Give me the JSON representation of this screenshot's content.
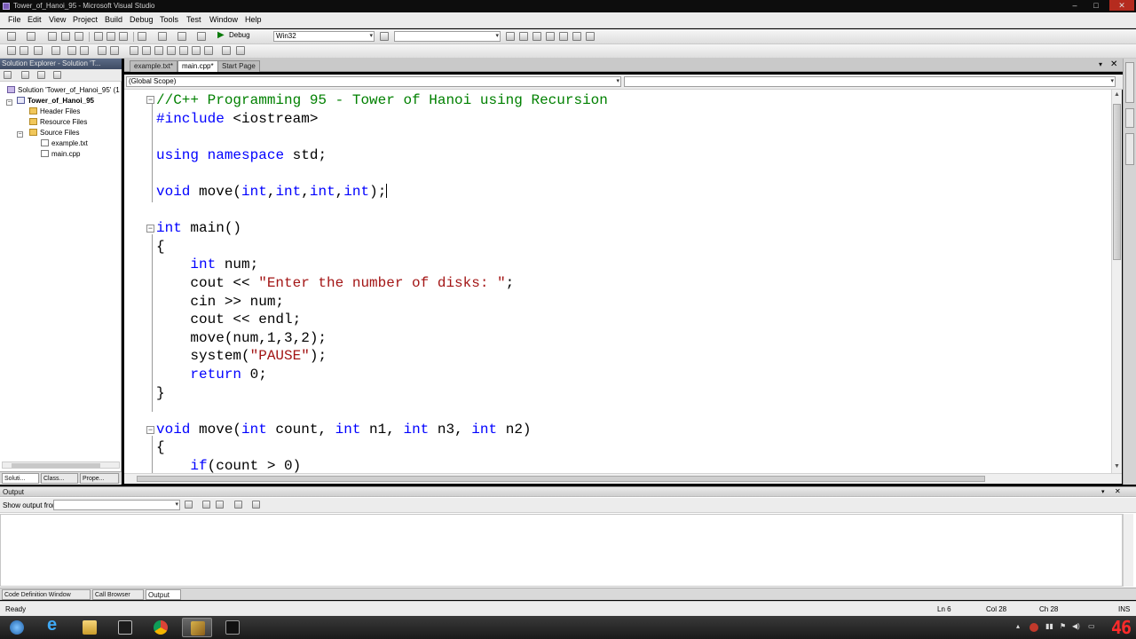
{
  "window": {
    "title": "Tower_of_Hanoi_95 - Microsoft Visual Studio"
  },
  "menu": [
    "File",
    "Edit",
    "View",
    "Project",
    "Build",
    "Debug",
    "Tools",
    "Test",
    "Window",
    "Help"
  ],
  "toolbar": {
    "configuration": "Debug",
    "platform": "Win32"
  },
  "solution_explorer": {
    "title": "Solution Explorer - Solution 'T...",
    "items": [
      {
        "label": "Solution 'Tower_of_Hanoi_95' (1",
        "icon": "solution-icon"
      },
      {
        "label": "Tower_of_Hanoi_95",
        "icon": "project-icon"
      },
      {
        "label": "Header Files",
        "icon": "folder-icon"
      },
      {
        "label": "Resource Files",
        "icon": "folder-icon"
      },
      {
        "label": "Source Files",
        "icon": "folder-icon"
      },
      {
        "label": "example.txt",
        "icon": "file-icon"
      },
      {
        "label": "main.cpp",
        "icon": "cpp-file-icon"
      }
    ],
    "bottom_tabs": [
      "Soluti...",
      "Class...",
      "Prope..."
    ]
  },
  "editor": {
    "tabs": [
      {
        "label": "example.txt*",
        "active": false
      },
      {
        "label": "main.cpp*",
        "active": true
      },
      {
        "label": "Start Page",
        "active": false
      }
    ],
    "scope_left": "(Global Scope)",
    "scope_right": "",
    "code_lines": [
      [
        {
          "t": "//C++ Programming 95 - Tower of Hanoi using Recursion",
          "c": "cm"
        }
      ],
      [
        {
          "t": "#include",
          "c": "pp"
        },
        {
          "t": " <iostream>",
          "c": ""
        }
      ],
      [],
      [
        {
          "t": "using",
          "c": "kw"
        },
        {
          "t": " ",
          "c": ""
        },
        {
          "t": "namespace",
          "c": "kw"
        },
        {
          "t": " std;",
          "c": ""
        }
      ],
      [],
      [
        {
          "t": "void",
          "c": "kw"
        },
        {
          "t": " move(",
          "c": ""
        },
        {
          "t": "int",
          "c": "kw"
        },
        {
          "t": ",",
          "c": ""
        },
        {
          "t": "int",
          "c": "kw"
        },
        {
          "t": ",",
          "c": ""
        },
        {
          "t": "int",
          "c": "kw"
        },
        {
          "t": ",",
          "c": ""
        },
        {
          "t": "int",
          "c": "kw"
        },
        {
          "t": ");",
          "c": ""
        },
        {
          "t": "",
          "c": "caret"
        }
      ],
      [],
      [
        {
          "t": "int",
          "c": "kw"
        },
        {
          "t": " main()",
          "c": ""
        }
      ],
      [
        {
          "t": "{",
          "c": ""
        }
      ],
      [
        {
          "t": "    ",
          "c": ""
        },
        {
          "t": "int",
          "c": "kw"
        },
        {
          "t": " num;",
          "c": ""
        }
      ],
      [
        {
          "t": "    cout << ",
          "c": ""
        },
        {
          "t": "\"Enter the number of disks: \"",
          "c": "st"
        },
        {
          "t": ";",
          "c": ""
        }
      ],
      [
        {
          "t": "    cin >> num;",
          "c": ""
        }
      ],
      [
        {
          "t": "    cout << endl;",
          "c": ""
        }
      ],
      [
        {
          "t": "    move(num,1,3,2);",
          "c": ""
        }
      ],
      [
        {
          "t": "    system(",
          "c": ""
        },
        {
          "t": "\"PAUSE\"",
          "c": "st"
        },
        {
          "t": ");",
          "c": ""
        }
      ],
      [
        {
          "t": "    ",
          "c": ""
        },
        {
          "t": "return",
          "c": "kw"
        },
        {
          "t": " 0;",
          "c": ""
        }
      ],
      [
        {
          "t": "}",
          "c": ""
        }
      ],
      [],
      [
        {
          "t": "void",
          "c": "kw"
        },
        {
          "t": " move(",
          "c": ""
        },
        {
          "t": "int",
          "c": "kw"
        },
        {
          "t": " count, ",
          "c": ""
        },
        {
          "t": "int",
          "c": "kw"
        },
        {
          "t": " n1, ",
          "c": ""
        },
        {
          "t": "int",
          "c": "kw"
        },
        {
          "t": " n3, ",
          "c": ""
        },
        {
          "t": "int",
          "c": "kw"
        },
        {
          "t": " n2)",
          "c": ""
        }
      ],
      [
        {
          "t": "{",
          "c": ""
        }
      ],
      [
        {
          "t": "    ",
          "c": ""
        },
        {
          "t": "if",
          "c": "kw"
        },
        {
          "t": "(count > 0)",
          "c": ""
        }
      ]
    ]
  },
  "output": {
    "title": "Output",
    "show_output_from": "Show output from:",
    "bottom_tabs": [
      "Code Definition Window",
      "Call Browser",
      "Output"
    ]
  },
  "statusbar": {
    "status": "Ready",
    "ln": "Ln 6",
    "col": "Col 28",
    "ch": "Ch 28",
    "mode": "INS"
  },
  "taskbar": {
    "clock": "46",
    "colors": {
      "clock": "#ff2a2a",
      "keyword": "#0000ff",
      "comment": "#008000",
      "string": "#a31515"
    }
  }
}
